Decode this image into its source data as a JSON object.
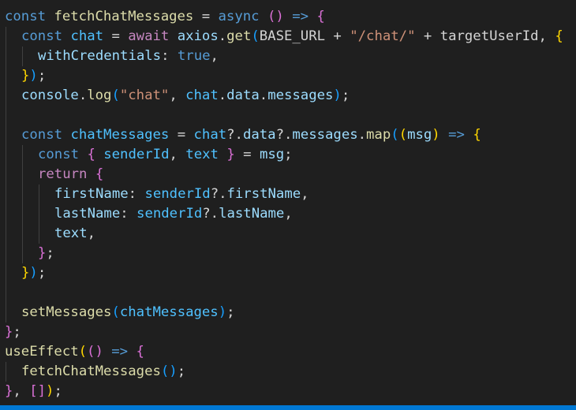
{
  "colors": {
    "background": "#1f1f1f",
    "keyword": "#569cd6",
    "control": "#c586c0",
    "variable": "#9cdcfe",
    "constant": "#4fc1ff",
    "function": "#dcdcaa",
    "string": "#ce9178",
    "punctuation": "#d4d4d4",
    "bracket1": "#ffd700",
    "bracket2": "#da70d6",
    "bracket3": "#179fff",
    "accent_bar": "#0078d4"
  },
  "code": {
    "lines": [
      {
        "indent": 0,
        "tokens": [
          {
            "t": "const",
            "k": "keyword"
          },
          {
            "t": " ",
            "k": "plain"
          },
          {
            "t": "fetchChatMessages",
            "k": "function"
          },
          {
            "t": " = ",
            "k": "plain"
          },
          {
            "t": "async",
            "k": "keyword"
          },
          {
            "t": " ",
            "k": "plain"
          },
          {
            "t": "()",
            "k": "bracket2"
          },
          {
            "t": " ",
            "k": "plain"
          },
          {
            "t": "=>",
            "k": "keyword"
          },
          {
            "t": " ",
            "k": "plain"
          },
          {
            "t": "{",
            "k": "bracket2"
          }
        ]
      },
      {
        "indent": 1,
        "tokens": [
          {
            "t": "const",
            "k": "keyword"
          },
          {
            "t": " ",
            "k": "plain"
          },
          {
            "t": "chat",
            "k": "constant"
          },
          {
            "t": " = ",
            "k": "plain"
          },
          {
            "t": "await",
            "k": "control"
          },
          {
            "t": " ",
            "k": "plain"
          },
          {
            "t": "axios",
            "k": "variable"
          },
          {
            "t": ".",
            "k": "plain"
          },
          {
            "t": "get",
            "k": "function"
          },
          {
            "t": "(",
            "k": "bracket3"
          },
          {
            "t": "BASE_URL",
            "k": "plain"
          },
          {
            "t": " + ",
            "k": "plain"
          },
          {
            "t": "\"/chat/\"",
            "k": "string"
          },
          {
            "t": " + ",
            "k": "plain"
          },
          {
            "t": "targetUserId",
            "k": "plain"
          },
          {
            "t": ", ",
            "k": "plain"
          },
          {
            "t": "{",
            "k": "bracket1"
          }
        ]
      },
      {
        "indent": 2,
        "tokens": [
          {
            "t": "withCredentials",
            "k": "variable"
          },
          {
            "t": ": ",
            "k": "plain"
          },
          {
            "t": "true",
            "k": "keyword"
          },
          {
            "t": ",",
            "k": "plain"
          }
        ]
      },
      {
        "indent": 1,
        "tokens": [
          {
            "t": "}",
            "k": "bracket1"
          },
          {
            "t": ")",
            "k": "bracket3"
          },
          {
            "t": ";",
            "k": "plain"
          }
        ]
      },
      {
        "indent": 1,
        "tokens": [
          {
            "t": "console",
            "k": "variable"
          },
          {
            "t": ".",
            "k": "plain"
          },
          {
            "t": "log",
            "k": "function"
          },
          {
            "t": "(",
            "k": "bracket3"
          },
          {
            "t": "\"chat\"",
            "k": "string"
          },
          {
            "t": ", ",
            "k": "plain"
          },
          {
            "t": "chat",
            "k": "constant"
          },
          {
            "t": ".",
            "k": "plain"
          },
          {
            "t": "data",
            "k": "variable"
          },
          {
            "t": ".",
            "k": "plain"
          },
          {
            "t": "messages",
            "k": "variable"
          },
          {
            "t": ")",
            "k": "bracket3"
          },
          {
            "t": ";",
            "k": "plain"
          }
        ]
      },
      {
        "indent": 1,
        "tokens": []
      },
      {
        "indent": 1,
        "tokens": [
          {
            "t": "const",
            "k": "keyword"
          },
          {
            "t": " ",
            "k": "plain"
          },
          {
            "t": "chatMessages",
            "k": "constant"
          },
          {
            "t": " = ",
            "k": "plain"
          },
          {
            "t": "chat",
            "k": "constant"
          },
          {
            "t": "?.",
            "k": "plain"
          },
          {
            "t": "data",
            "k": "variable"
          },
          {
            "t": "?.",
            "k": "plain"
          },
          {
            "t": "messages",
            "k": "variable"
          },
          {
            "t": ".",
            "k": "plain"
          },
          {
            "t": "map",
            "k": "function"
          },
          {
            "t": "(",
            "k": "bracket3"
          },
          {
            "t": "(",
            "k": "bracket1"
          },
          {
            "t": "msg",
            "k": "variable"
          },
          {
            "t": ")",
            "k": "bracket1"
          },
          {
            "t": " ",
            "k": "plain"
          },
          {
            "t": "=>",
            "k": "keyword"
          },
          {
            "t": " ",
            "k": "plain"
          },
          {
            "t": "{",
            "k": "bracket1"
          }
        ]
      },
      {
        "indent": 2,
        "tokens": [
          {
            "t": "const",
            "k": "keyword"
          },
          {
            "t": " ",
            "k": "plain"
          },
          {
            "t": "{",
            "k": "bracket2"
          },
          {
            "t": " ",
            "k": "plain"
          },
          {
            "t": "senderId",
            "k": "constant"
          },
          {
            "t": ", ",
            "k": "plain"
          },
          {
            "t": "text",
            "k": "constant"
          },
          {
            "t": " ",
            "k": "plain"
          },
          {
            "t": "}",
            "k": "bracket2"
          },
          {
            "t": " = ",
            "k": "plain"
          },
          {
            "t": "msg",
            "k": "variable"
          },
          {
            "t": ";",
            "k": "plain"
          }
        ]
      },
      {
        "indent": 2,
        "tokens": [
          {
            "t": "return",
            "k": "control"
          },
          {
            "t": " ",
            "k": "plain"
          },
          {
            "t": "{",
            "k": "bracket2"
          }
        ]
      },
      {
        "indent": 3,
        "tokens": [
          {
            "t": "firstName",
            "k": "variable"
          },
          {
            "t": ": ",
            "k": "plain"
          },
          {
            "t": "senderId",
            "k": "constant"
          },
          {
            "t": "?.",
            "k": "plain"
          },
          {
            "t": "firstName",
            "k": "variable"
          },
          {
            "t": ",",
            "k": "plain"
          }
        ]
      },
      {
        "indent": 3,
        "tokens": [
          {
            "t": "lastName",
            "k": "variable"
          },
          {
            "t": ": ",
            "k": "plain"
          },
          {
            "t": "senderId",
            "k": "constant"
          },
          {
            "t": "?.",
            "k": "plain"
          },
          {
            "t": "lastName",
            "k": "variable"
          },
          {
            "t": ",",
            "k": "plain"
          }
        ]
      },
      {
        "indent": 3,
        "tokens": [
          {
            "t": "text",
            "k": "variable"
          },
          {
            "t": ",",
            "k": "plain"
          }
        ]
      },
      {
        "indent": 2,
        "tokens": [
          {
            "t": "}",
            "k": "bracket2"
          },
          {
            "t": ";",
            "k": "plain"
          }
        ]
      },
      {
        "indent": 1,
        "tokens": [
          {
            "t": "}",
            "k": "bracket1"
          },
          {
            "t": ")",
            "k": "bracket3"
          },
          {
            "t": ";",
            "k": "plain"
          }
        ]
      },
      {
        "indent": 1,
        "tokens": []
      },
      {
        "indent": 1,
        "tokens": [
          {
            "t": "setMessages",
            "k": "function"
          },
          {
            "t": "(",
            "k": "bracket3"
          },
          {
            "t": "chatMessages",
            "k": "constant"
          },
          {
            "t": ")",
            "k": "bracket3"
          },
          {
            "t": ";",
            "k": "plain"
          }
        ]
      },
      {
        "indent": 0,
        "tokens": [
          {
            "t": "}",
            "k": "bracket2"
          },
          {
            "t": ";",
            "k": "plain"
          }
        ]
      },
      {
        "indent": 0,
        "tokens": [
          {
            "t": "useEffect",
            "k": "function"
          },
          {
            "t": "(",
            "k": "bracket1"
          },
          {
            "t": "()",
            "k": "bracket2"
          },
          {
            "t": " ",
            "k": "plain"
          },
          {
            "t": "=>",
            "k": "keyword"
          },
          {
            "t": " ",
            "k": "plain"
          },
          {
            "t": "{",
            "k": "bracket2"
          }
        ]
      },
      {
        "indent": 1,
        "tokens": [
          {
            "t": "fetchChatMessages",
            "k": "function"
          },
          {
            "t": "()",
            "k": "bracket3"
          },
          {
            "t": ";",
            "k": "plain"
          }
        ]
      },
      {
        "indent": 0,
        "tokens": [
          {
            "t": "}",
            "k": "bracket2"
          },
          {
            "t": ", ",
            "k": "plain"
          },
          {
            "t": "[]",
            "k": "bracket2"
          },
          {
            "t": ")",
            "k": "bracket1"
          },
          {
            "t": ";",
            "k": "plain"
          }
        ]
      }
    ]
  }
}
